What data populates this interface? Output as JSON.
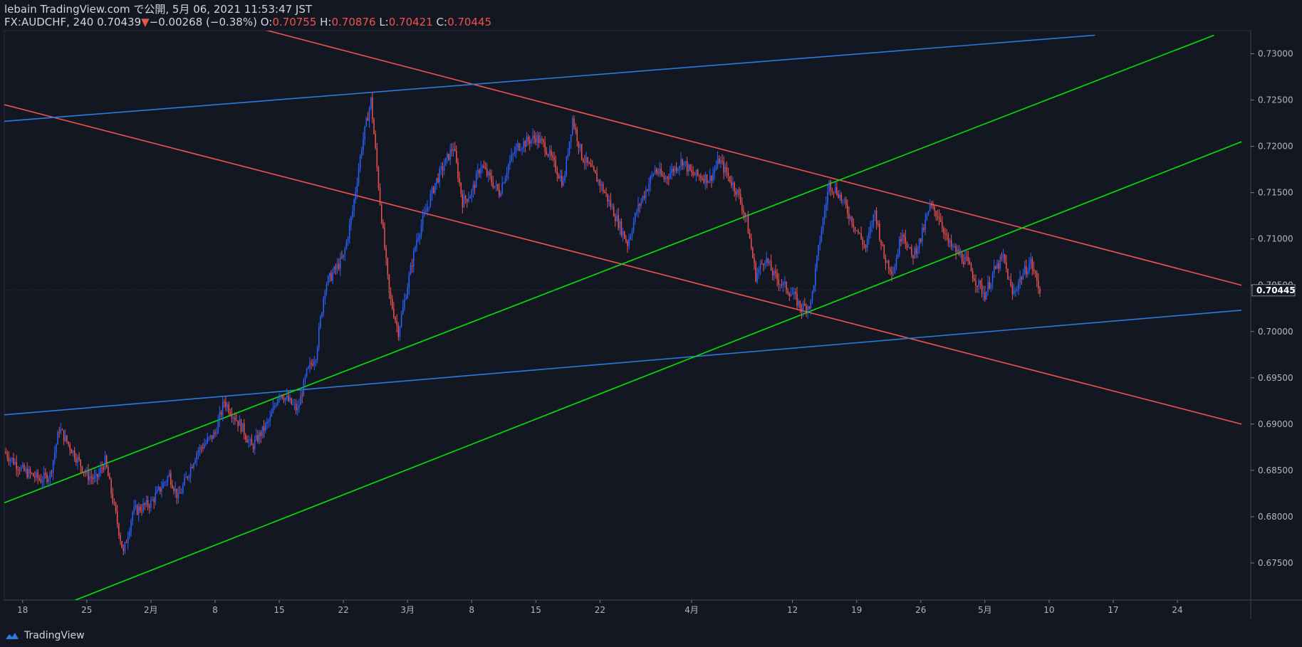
{
  "header": {
    "line1": "lebain TradingView.com で公開, 5月 06, 2021 11:53:47 JST",
    "symbol": "FX:AUDCHF, 240",
    "last": "0.70439",
    "change_arrow": "▼",
    "change": "−0.00268 (−0.38%)",
    "o_label": "O:",
    "o_val": "0.70755",
    "h_label": "H:",
    "h_val": "0.70876",
    "l_label": "L:",
    "l_val": "0.70421",
    "c_label": "C:",
    "c_val": "0.70445"
  },
  "watermark": {
    "text": "TradingView",
    "icon": "tradingview-cloud-icon"
  },
  "colors": {
    "bg": "#131722",
    "up": "#2962ff",
    "down": "#ef5350",
    "green": "#00e600",
    "blue": "#2a7bdf",
    "axis": "#787b86"
  },
  "chart_data": {
    "type": "candlestick",
    "symbol": "FX:AUDCHF",
    "interval": "240",
    "ylim": [
      0.671,
      0.7325
    ],
    "xlim": [
      "2021-01-16",
      "2021-06-01"
    ],
    "y_ticks": [
      "0.67500",
      "0.68000",
      "0.68500",
      "0.69000",
      "0.69500",
      "0.70000",
      "0.70500",
      "0.71000",
      "0.71500",
      "0.72000",
      "0.72500",
      "0.73000"
    ],
    "current_price_label": "0.70445",
    "x_ticks": [
      {
        "date": "2021-01-18",
        "label": "18"
      },
      {
        "date": "2021-01-25",
        "label": "25"
      },
      {
        "date": "2021-02-01",
        "label": "2月"
      },
      {
        "date": "2021-02-08",
        "label": "8"
      },
      {
        "date": "2021-02-15",
        "label": "15"
      },
      {
        "date": "2021-02-22",
        "label": "22"
      },
      {
        "date": "2021-03-01",
        "label": "3月"
      },
      {
        "date": "2021-03-08",
        "label": "8"
      },
      {
        "date": "2021-03-15",
        "label": "15"
      },
      {
        "date": "2021-03-22",
        "label": "22"
      },
      {
        "date": "2021-04-01",
        "label": "4月"
      },
      {
        "date": "2021-04-12",
        "label": "12"
      },
      {
        "date": "2021-04-19",
        "label": "19"
      },
      {
        "date": "2021-04-26",
        "label": "26"
      },
      {
        "date": "2021-05-03",
        "label": "5月"
      },
      {
        "date": "2021-05-10",
        "label": "10"
      },
      {
        "date": "2021-05-17",
        "label": "17"
      },
      {
        "date": "2021-05-24",
        "label": "24"
      }
    ],
    "price_path": [
      [
        "2021-01-16",
        0.687
      ],
      [
        "2021-01-18",
        0.685
      ],
      [
        "2021-01-20",
        0.684
      ],
      [
        "2021-01-21",
        0.6845
      ],
      [
        "2021-01-22",
        0.6895
      ],
      [
        "2021-01-25",
        0.6845
      ],
      [
        "2021-01-26",
        0.684
      ],
      [
        "2021-01-27",
        0.686
      ],
      [
        "2021-01-28",
        0.681
      ],
      [
        "2021-01-29",
        0.676
      ],
      [
        "2021-01-30",
        0.6805
      ],
      [
        "2021-02-01",
        0.6815
      ],
      [
        "2021-02-03",
        0.6845
      ],
      [
        "2021-02-04",
        0.682
      ],
      [
        "2021-02-06",
        0.687
      ],
      [
        "2021-02-08",
        0.689
      ],
      [
        "2021-02-09",
        0.6925
      ],
      [
        "2021-02-11",
        0.6895
      ],
      [
        "2021-02-12",
        0.6875
      ],
      [
        "2021-02-14",
        0.6905
      ],
      [
        "2021-02-15",
        0.6935
      ],
      [
        "2021-02-17",
        0.6915
      ],
      [
        "2021-02-18",
        0.6955
      ],
      [
        "2021-02-19",
        0.6975
      ],
      [
        "2021-02-20",
        0.705
      ],
      [
        "2021-02-22",
        0.708
      ],
      [
        "2021-02-23",
        0.713
      ],
      [
        "2021-02-24",
        0.72
      ],
      [
        "2021-02-25",
        0.725
      ],
      [
        "2021-02-26",
        0.714
      ],
      [
        "2021-02-27",
        0.704
      ],
      [
        "2021-02-28",
        0.7
      ],
      [
        "2021-03-02",
        0.71
      ],
      [
        "2021-03-03",
        0.713
      ],
      [
        "2021-03-04",
        0.716
      ],
      [
        "2021-03-05",
        0.718
      ],
      [
        "2021-03-06",
        0.72
      ],
      [
        "2021-03-07",
        0.714
      ],
      [
        "2021-03-08",
        0.715
      ],
      [
        "2021-03-09",
        0.718
      ],
      [
        "2021-03-11",
        0.715
      ],
      [
        "2021-03-12",
        0.718
      ],
      [
        "2021-03-13",
        0.72
      ],
      [
        "2021-03-15",
        0.721
      ],
      [
        "2021-03-16",
        0.72
      ],
      [
        "2021-03-17",
        0.718
      ],
      [
        "2021-03-18",
        0.716
      ],
      [
        "2021-03-19",
        0.723
      ],
      [
        "2021-03-20",
        0.719
      ],
      [
        "2021-03-22",
        0.716
      ],
      [
        "2021-03-23",
        0.714
      ],
      [
        "2021-03-25",
        0.7095
      ],
      [
        "2021-03-26",
        0.713
      ],
      [
        "2021-03-28",
        0.7175
      ],
      [
        "2021-03-29",
        0.7165
      ],
      [
        "2021-03-31",
        0.7185
      ],
      [
        "2021-04-01",
        0.717
      ],
      [
        "2021-04-03",
        0.7165
      ],
      [
        "2021-04-04",
        0.7185
      ],
      [
        "2021-04-06",
        0.715
      ],
      [
        "2021-04-07",
        0.712
      ],
      [
        "2021-04-08",
        0.706
      ],
      [
        "2021-04-09",
        0.708
      ],
      [
        "2021-04-10",
        0.706
      ],
      [
        "2021-04-12",
        0.704
      ],
      [
        "2021-04-13",
        0.7025
      ],
      [
        "2021-04-14",
        0.703
      ],
      [
        "2021-04-15",
        0.71
      ],
      [
        "2021-04-16",
        0.716
      ],
      [
        "2021-04-17",
        0.715
      ],
      [
        "2021-04-19",
        0.711
      ],
      [
        "2021-04-20",
        0.709
      ],
      [
        "2021-04-21",
        0.713
      ],
      [
        "2021-04-22",
        0.708
      ],
      [
        "2021-04-23",
        0.7065
      ],
      [
        "2021-04-24",
        0.711
      ],
      [
        "2021-04-25",
        0.708
      ],
      [
        "2021-04-26",
        0.71
      ],
      [
        "2021-04-27",
        0.7135
      ],
      [
        "2021-04-28",
        0.7125
      ],
      [
        "2021-04-29",
        0.7095
      ],
      [
        "2021-04-30",
        0.7085
      ],
      [
        "2021-05-01",
        0.7075
      ],
      [
        "2021-05-02",
        0.7055
      ],
      [
        "2021-05-03",
        0.704
      ],
      [
        "2021-05-04",
        0.7065
      ],
      [
        "2021-05-05",
        0.708
      ],
      [
        "2021-05-06",
        0.704
      ],
      [
        "2021-05-07",
        0.706
      ],
      [
        "2021-05-08",
        0.7075
      ],
      [
        "2021-05-09",
        0.7044
      ]
    ],
    "trend_lines": [
      {
        "color": "red",
        "from": [
          "2021-02-01",
          0.7358
        ],
        "to": [
          "2021-05-31",
          0.705
        ]
      },
      {
        "color": "red",
        "from": [
          "2021-01-16",
          0.7245
        ],
        "to": [
          "2021-05-31",
          0.69
        ]
      },
      {
        "color": "blue",
        "from": [
          "2021-01-16",
          0.7227
        ],
        "to": [
          "2021-05-15",
          0.732
        ]
      },
      {
        "color": "blue",
        "from": [
          "2021-01-16",
          0.691
        ],
        "to": [
          "2021-05-31",
          0.7023
        ]
      },
      {
        "color": "green",
        "from": [
          "2021-01-16",
          0.6815
        ],
        "to": [
          "2021-05-28",
          0.732
        ]
      },
      {
        "color": "green",
        "from": [
          "2021-01-23",
          0.6707
        ],
        "to": [
          "2021-05-31",
          0.7205
        ]
      }
    ]
  }
}
